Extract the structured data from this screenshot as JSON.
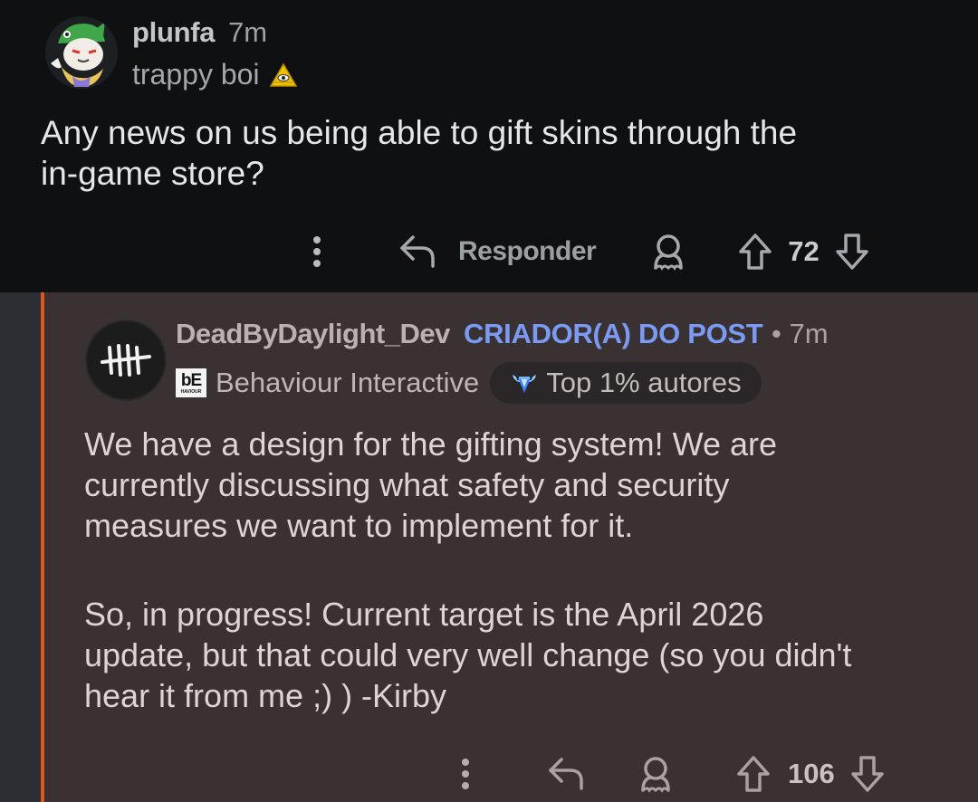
{
  "parent_comment": {
    "username": "plunfa",
    "time": "7m",
    "flair_text": "trappy boi",
    "flair_icon": "illuminati-triangle-icon",
    "body": [
      "Any news on us being able to gift skins through the",
      "in-game store?"
    ],
    "actions": {
      "more_icon": "more-vertical-icon",
      "reply_icon": "reply-arrow-icon",
      "reply_label": "Responder",
      "award_icon": "award-icon",
      "upvote_icon": "upvote-arrow-icon",
      "score": "72",
      "downvote_icon": "downvote-arrow-icon"
    }
  },
  "reply_comment": {
    "username": "DeadByDaylight_Dev",
    "op_badge": "CRIADOR(A) DO POST",
    "separator": "•",
    "time": "7m",
    "company_logo_text": "bE",
    "company_logo_subtext": "HAVIOUR",
    "company_name": "Behaviour Interactive",
    "top_badge_icon": "diamond-trophy-icon",
    "top_badge": "Top 1% autores",
    "paragraph1": [
      "We have a design for the gifting system! We are",
      "currently discussing what safety and security",
      "measures we want to implement for it."
    ],
    "paragraph2": [
      "So, in progress! Current target is the April 2026",
      "update, but that could very well change (so you didn't",
      "hear it from me ;) ) -Kirby"
    ],
    "actions": {
      "more_icon": "more-vertical-icon",
      "reply_icon": "reply-arrow-icon",
      "award_icon": "award-icon",
      "upvote_icon": "upvote-arrow-icon",
      "score": "106",
      "downvote_icon": "downvote-arrow-icon"
    }
  },
  "colors": {
    "parent_bg": "#0e1012",
    "reply_bg": "#3a3232",
    "thread_line": "#e2561d",
    "op_badge": "#7b9af3"
  }
}
